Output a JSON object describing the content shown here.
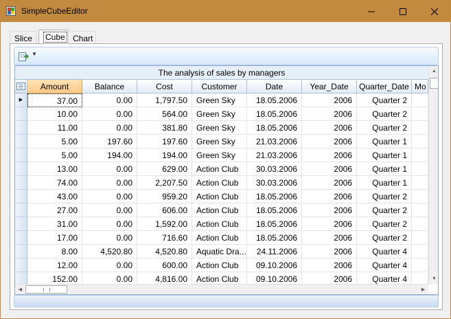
{
  "window": {
    "title": "SimpleCubeEditor"
  },
  "tabs": [
    {
      "label": "Slice",
      "active": false
    },
    {
      "label": "Cube",
      "active": true
    },
    {
      "label": "Chart",
      "active": false
    }
  ],
  "grid": {
    "title": "The analysis of sales by managers",
    "columns": [
      "Amount",
      "Balance",
      "Cost",
      "Customer",
      "Date",
      "Year_Date",
      "Quarter_Date",
      "Mo"
    ],
    "rows": [
      [
        "37.00",
        "0.00",
        "1,797.50",
        "Green  Sky",
        "18.05.2006",
        "2006",
        "Quarter 2"
      ],
      [
        "10.00",
        "0.00",
        "564.00",
        "Green  Sky",
        "18.05.2006",
        "2006",
        "Quarter 2"
      ],
      [
        "11.00",
        "0.00",
        "381.80",
        "Green  Sky",
        "18.05.2006",
        "2006",
        "Quarter 2"
      ],
      [
        "5.00",
        "197.60",
        "197.60",
        "Green  Sky",
        "21.03.2006",
        "2006",
        "Quarter 1"
      ],
      [
        "5.00",
        "194.00",
        "194.00",
        "Green  Sky",
        "21.03.2006",
        "2006",
        "Quarter 1"
      ],
      [
        "13.00",
        "0.00",
        "629.00",
        "Action Club",
        "30.03.2006",
        "2006",
        "Quarter 1"
      ],
      [
        "74.00",
        "0.00",
        "2,207.50",
        "Action Club",
        "30.03.2006",
        "2006",
        "Quarter 1"
      ],
      [
        "43.00",
        "0.00",
        "959.20",
        "Action Club",
        "18.05.2006",
        "2006",
        "Quarter 2"
      ],
      [
        "27.00",
        "0.00",
        "606.00",
        "Action Club",
        "18.05.2006",
        "2006",
        "Quarter 2"
      ],
      [
        "31.00",
        "0.00",
        "1,592.00",
        "Action Club",
        "18.05.2006",
        "2006",
        "Quarter 2"
      ],
      [
        "17.00",
        "0.00",
        "716.60",
        "Action Club",
        "18.05.2006",
        "2006",
        "Quarter 2"
      ],
      [
        "8.00",
        "4,520.80",
        "4,520.80",
        "Aquatic Dra...",
        "24.11.2006",
        "2006",
        "Quarter 4"
      ],
      [
        "12.00",
        "0.00",
        "600.00",
        "Action Club",
        "09.10.2006",
        "2006",
        "Quarter 4"
      ],
      [
        "152.00",
        "0.00",
        "4,816.00",
        "Action Club",
        "09.10.2006",
        "2006",
        "Quarter 4"
      ]
    ]
  },
  "icons": {
    "app": "app-icon",
    "toolbar": "export-icon",
    "toolbar_dropdown": "chevron-down-icon"
  },
  "colors": {
    "titlebar": "#c18a3f",
    "selected_header": "#ffc986",
    "toolbar": "#d6e8fa"
  }
}
